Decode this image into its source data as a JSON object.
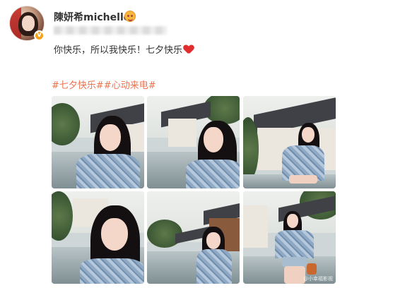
{
  "user": {
    "name": "陳妍希michelle",
    "verified_badge": "V"
  },
  "post": {
    "text": "你快乐，所以我快乐！七夕快乐",
    "hashtags": [
      "#七夕快乐#",
      "#心动来电#"
    ]
  },
  "icons": {
    "heart": "heart-icon",
    "vip": "vip-icon",
    "verified": "verified-icon"
  },
  "colors": {
    "hashtag": "#eb7350",
    "heart": "#e02e2e",
    "verified": "#f7a21b"
  },
  "photos": [
    {
      "name": "photo-1"
    },
    {
      "name": "photo-2"
    },
    {
      "name": "photo-3"
    },
    {
      "name": "photo-4"
    },
    {
      "name": "photo-5"
    },
    {
      "name": "photo-6",
      "watermark": "@小幸福影视"
    }
  ]
}
